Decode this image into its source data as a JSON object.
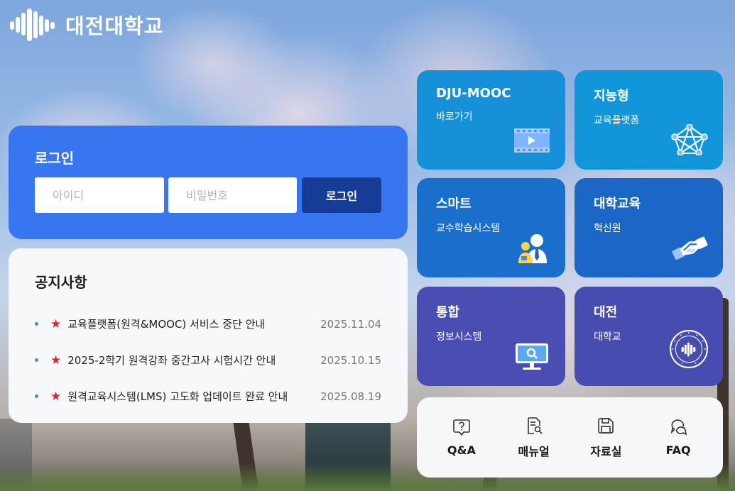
{
  "brand": {
    "name": "대전대학교",
    "logo_icon": "daejeon-wave-logo-icon"
  },
  "login": {
    "title": "로그인",
    "id_placeholder": "아이디",
    "pw_placeholder": "비밀번호",
    "button_label": "로그인"
  },
  "notice": {
    "title": "공지사항",
    "items": [
      {
        "text": "교육플랫폼(원격&MOOC) 서비스 중단 안내",
        "date": "2025.11.04"
      },
      {
        "text": "2025-2학기 원격강좌 중간고사 시험시간 안내",
        "date": "2025.10.15"
      },
      {
        "text": "원격교육시스템(LMS) 고도화 업데이트 완료 안내",
        "date": "2025.08.19"
      }
    ]
  },
  "tiles": [
    {
      "title": "DJU-MOOC",
      "subtitle": "바로가기",
      "icon": "video-play-icon",
      "color": "#1690d9"
    },
    {
      "title": "지능형",
      "subtitle": "교육플랫폼",
      "icon": "network-pentagon-icon",
      "color": "#1196da"
    },
    {
      "title": "스마트",
      "subtitle": "교수학습시스템",
      "icon": "teacher-student-icon",
      "color": "#1a6fcc"
    },
    {
      "title": "대학교육",
      "subtitle": "혁신원",
      "icon": "handshake-icon",
      "color": "#1b66c6"
    },
    {
      "title": "통합",
      "subtitle": "정보시스템",
      "icon": "monitor-search-icon",
      "color": "#4a4eb3"
    },
    {
      "title": "대전",
      "subtitle": "대학교",
      "icon": "university-seal-icon",
      "color": "#474cb1"
    }
  ],
  "quick_links": [
    {
      "label": "Q&A",
      "icon": "question-bubble-icon"
    },
    {
      "label": "매뉴얼",
      "icon": "manual-search-icon"
    },
    {
      "label": "자료실",
      "icon": "floppy-disk-icon"
    },
    {
      "label": "FAQ",
      "icon": "chat-bubbles-icon"
    }
  ]
}
